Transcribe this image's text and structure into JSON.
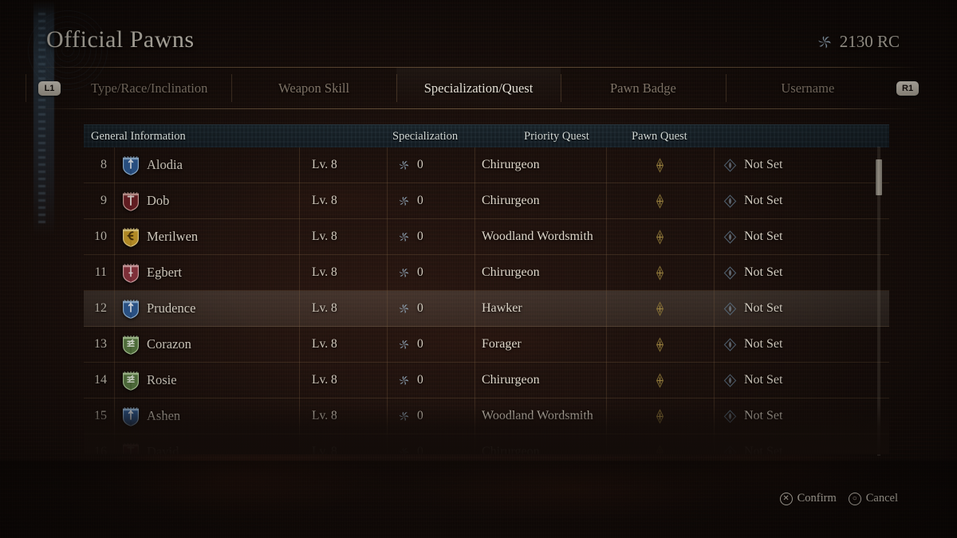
{
  "header": {
    "title": "Official Pawns",
    "currency_value": "2130 RC",
    "currency_icon": "rift-crystal-icon"
  },
  "tabbar": {
    "left_bumper": "L1",
    "right_bumper": "R1",
    "tabs": [
      {
        "label": "Type/Race/Inclination",
        "active": false
      },
      {
        "label": "Weapon Skill",
        "active": false
      },
      {
        "label": "Specialization/Quest",
        "active": true
      },
      {
        "label": "Pawn Badge",
        "active": false
      },
      {
        "label": "Username",
        "active": false
      }
    ]
  },
  "table": {
    "columns": [
      {
        "key": "general",
        "label": "General Information"
      },
      {
        "key": "specialization",
        "label": "Specialization"
      },
      {
        "key": "priority_quest",
        "label": "Priority Quest"
      },
      {
        "key": "pawn_quest",
        "label": "Pawn Quest"
      }
    ],
    "rows": [
      {
        "num": "8",
        "name": "Alodia",
        "vocation": "fighter",
        "level": "Lv. 8",
        "rc": "0",
        "specialization": "Chirurgeon",
        "priority_quest": "",
        "pawn_quest": "Not Set",
        "selected": false,
        "faded": false
      },
      {
        "num": "9",
        "name": "Dob",
        "vocation": "warrior",
        "level": "Lv. 8",
        "rc": "0",
        "specialization": "Chirurgeon",
        "priority_quest": "",
        "pawn_quest": "Not Set",
        "selected": false,
        "faded": false
      },
      {
        "num": "10",
        "name": "Merilwen",
        "vocation": "mage",
        "level": "Lv. 8",
        "rc": "0",
        "specialization": "Woodland Wordsmith",
        "priority_quest": "",
        "pawn_quest": "Not Set",
        "selected": false,
        "faded": false
      },
      {
        "num": "11",
        "name": "Egbert",
        "vocation": "thief",
        "level": "Lv. 8",
        "rc": "0",
        "specialization": "Chirurgeon",
        "priority_quest": "",
        "pawn_quest": "Not Set",
        "selected": false,
        "faded": false
      },
      {
        "num": "12",
        "name": "Prudence",
        "vocation": "fighter",
        "level": "Lv. 8",
        "rc": "0",
        "specialization": "Hawker",
        "priority_quest": "",
        "pawn_quest": "Not Set",
        "selected": true,
        "faded": false
      },
      {
        "num": "13",
        "name": "Corazon",
        "vocation": "archer",
        "level": "Lv. 8",
        "rc": "0",
        "specialization": "Forager",
        "priority_quest": "",
        "pawn_quest": "Not Set",
        "selected": false,
        "faded": false
      },
      {
        "num": "14",
        "name": "Rosie",
        "vocation": "archer",
        "level": "Lv. 8",
        "rc": "0",
        "specialization": "Chirurgeon",
        "priority_quest": "",
        "pawn_quest": "Not Set",
        "selected": false,
        "faded": false
      },
      {
        "num": "15",
        "name": "Ashen",
        "vocation": "fighter",
        "level": "Lv. 8",
        "rc": "0",
        "specialization": "Woodland Wordsmith",
        "priority_quest": "",
        "pawn_quest": "Not Set",
        "selected": false,
        "faded": false
      },
      {
        "num": "16",
        "name": "David",
        "vocation": "warrior",
        "level": "Lv. 8",
        "rc": "0",
        "specialization": "Chirurgeon",
        "priority_quest": "",
        "pawn_quest": "Not Set",
        "selected": false,
        "faded": true
      }
    ]
  },
  "footer": {
    "confirm_key": "✕",
    "confirm_label": "Confirm",
    "cancel_key": "○",
    "cancel_label": "Cancel"
  },
  "colors": {
    "fighter_shield": "#2f5c96",
    "warrior_shield": "#6e2026",
    "mage_shield": "#c79a2a",
    "thief_shield": "#8e3540",
    "archer_shield": "#5c7f45",
    "text_primary": "#ddd6c9",
    "text_muted": "#8d8072",
    "header_bg": "#152028",
    "selection": "#e8e1d0"
  }
}
